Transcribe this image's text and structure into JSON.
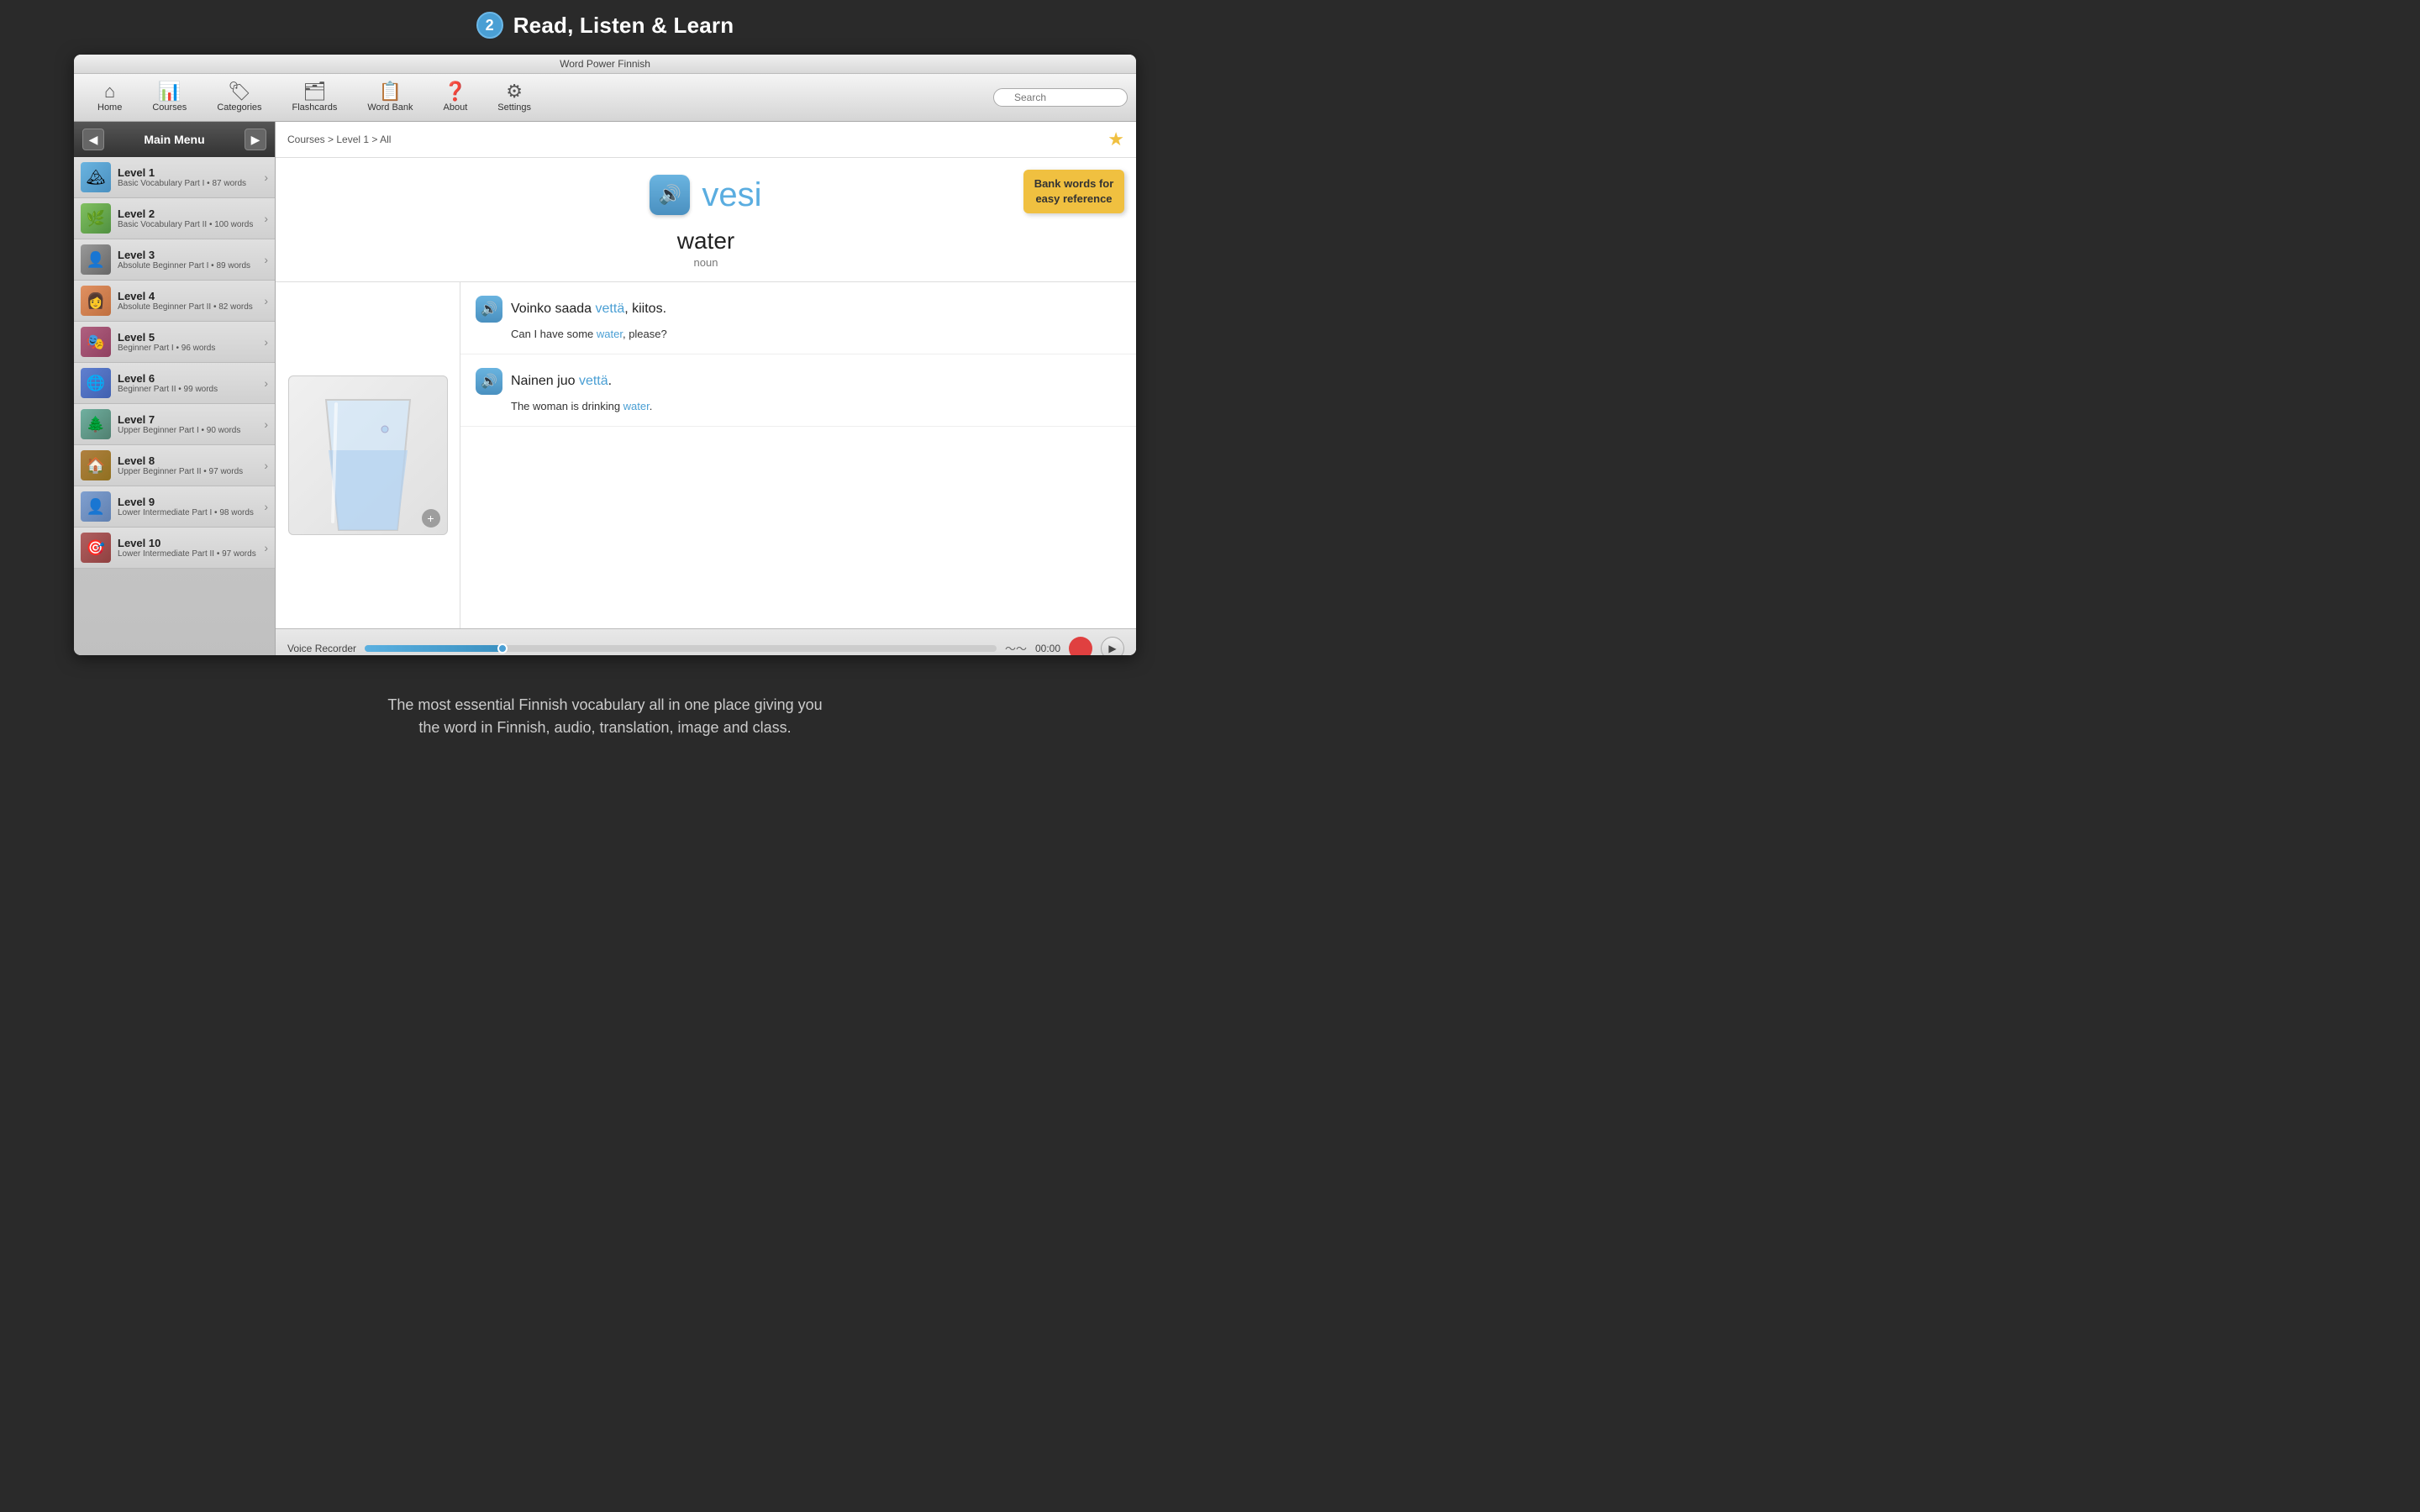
{
  "app": {
    "step": "2",
    "title": "Read, Listen & Learn",
    "window_title": "Word Power Finnish"
  },
  "toolbar": {
    "home_label": "Home",
    "courses_label": "Courses",
    "categories_label": "Categories",
    "flashcards_label": "Flashcards",
    "word_bank_label": "Word Bank",
    "about_label": "About",
    "settings_label": "Settings",
    "search_placeholder": "Search"
  },
  "sidebar": {
    "title": "Main Menu",
    "back_label": "◀",
    "forward_label": "▶",
    "levels": [
      {
        "name": "Level 1",
        "desc": "Basic Vocabulary Part I • 87 words",
        "thumb": "🏔",
        "class": "thumb-1"
      },
      {
        "name": "Level 2",
        "desc": "Basic Vocabulary Part II • 100 words",
        "thumb": "🌿",
        "class": "thumb-2"
      },
      {
        "name": "Level 3",
        "desc": "Absolute Beginner Part I • 89 words",
        "thumb": "👤",
        "class": "thumb-3"
      },
      {
        "name": "Level 4",
        "desc": "Absolute Beginner Part II • 82 words",
        "thumb": "👩",
        "class": "thumb-4"
      },
      {
        "name": "Level 5",
        "desc": "Beginner Part I • 96 words",
        "thumb": "🎭",
        "class": "thumb-5"
      },
      {
        "name": "Level 6",
        "desc": "Beginner Part II • 99 words",
        "thumb": "🌐",
        "class": "thumb-6"
      },
      {
        "name": "Level 7",
        "desc": "Upper Beginner Part I • 90 words",
        "thumb": "🌲",
        "class": "thumb-7"
      },
      {
        "name": "Level 8",
        "desc": "Upper Beginner Part II • 97 words",
        "thumb": "🏠",
        "class": "thumb-8"
      },
      {
        "name": "Level 9",
        "desc": "Lower Intermediate Part I • 98 words",
        "thumb": "👤",
        "class": "thumb-9"
      },
      {
        "name": "Level 10",
        "desc": "Lower Intermediate Part II • 97 words",
        "thumb": "🎯",
        "class": "thumb-10"
      }
    ]
  },
  "content": {
    "breadcrumb": "Courses > Level 1 > All",
    "finnish_word": "vesi",
    "english_word": "water",
    "word_class": "noun",
    "bank_tooltip": "Bank words for easy reference",
    "sentences": [
      {
        "fi_before": "Voinko saada ",
        "fi_highlight": "vettä",
        "fi_after": ", kiitos.",
        "en_before": "Can I have some ",
        "en_highlight": "water",
        "en_after": ", please?"
      },
      {
        "fi_before": "Nainen juo ",
        "fi_highlight": "vettä",
        "fi_after": ".",
        "en_before": "The woman is drinking ",
        "en_highlight": "water",
        "en_after": "."
      }
    ]
  },
  "voice_recorder": {
    "label": "Voice Recorder",
    "time": "00:00",
    "progress": 22
  },
  "bottom_caption": {
    "line1": "The most essential Finnish vocabulary all in one place giving you",
    "line2": "the word in Finnish, audio, translation, image and class."
  }
}
